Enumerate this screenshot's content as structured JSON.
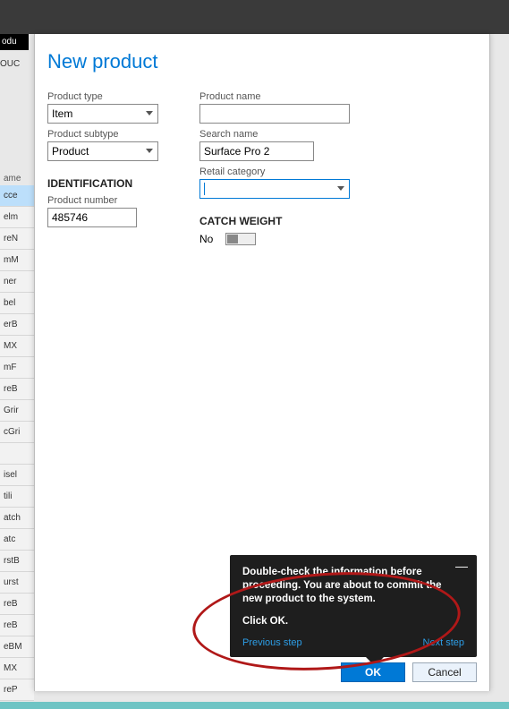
{
  "topbar": {},
  "prodTab": "odu",
  "oucLabel": "OUC",
  "sidebar": {
    "header": "ame",
    "items": [
      "cce",
      "elm",
      "reN",
      "mM",
      "ner",
      "bel",
      "erB",
      "MX",
      "mF",
      "reB",
      "Grir",
      "cGri",
      "",
      "isel",
      "tili",
      "atch",
      "atc",
      "rstB",
      "urst",
      "reB",
      "reB",
      "eBM",
      "MX",
      "reP"
    ],
    "selectedIndex": 0
  },
  "dialog": {
    "title": "New product",
    "fields": {
      "productType": {
        "label": "Product type",
        "value": "Item"
      },
      "productSubtype": {
        "label": "Product subtype",
        "value": "Product"
      },
      "productName": {
        "label": "Product name",
        "value": ""
      },
      "searchName": {
        "label": "Search name",
        "value": "Surface Pro 2"
      },
      "retailCategory": {
        "label": "Retail category",
        "value": ""
      },
      "identificationHeader": "IDENTIFICATION",
      "productNumber": {
        "label": "Product number",
        "value": "485746"
      },
      "catchWeightHeader": "CATCH WEIGHT",
      "catchWeightValue": "No"
    },
    "buttons": {
      "ok": "OK",
      "cancel": "Cancel"
    }
  },
  "tooltip": {
    "body": "Double-check the information before proceeding. You are about to commit the new product to the system.",
    "action": "Click OK.",
    "prev": "Previous step",
    "next": "Next step"
  }
}
